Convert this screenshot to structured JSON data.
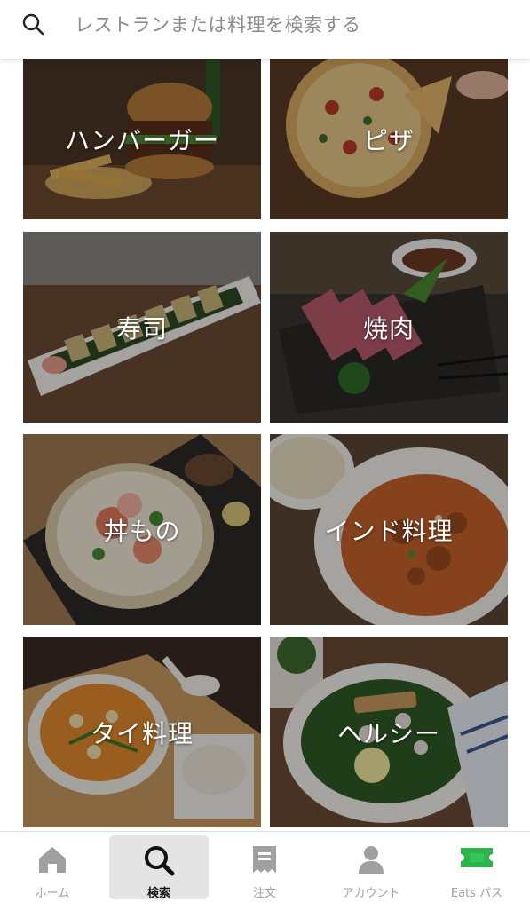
{
  "search": {
    "placeholder": "レストランまたは料理を検索する",
    "icon": "search-icon"
  },
  "categories": [
    {
      "label": "ハンバーガー"
    },
    {
      "label": "ピザ"
    },
    {
      "label": "寿司"
    },
    {
      "label": "焼肉"
    },
    {
      "label": "丼もの"
    },
    {
      "label": "インド料理"
    },
    {
      "label": "タイ料理"
    },
    {
      "label": "ヘルシー"
    }
  ],
  "tabbar": {
    "items": [
      {
        "label": "ホーム",
        "icon": "home-icon"
      },
      {
        "label": "検索",
        "icon": "search-icon"
      },
      {
        "label": "注文",
        "icon": "receipt-icon"
      },
      {
        "label": "アカウント",
        "icon": "person-icon"
      },
      {
        "label": "Eats パス",
        "icon": "ticket-icon"
      }
    ],
    "active_index": 1
  },
  "colors": {
    "accent_green": "#2cb34a",
    "inactive_gray": "#a0a0a0",
    "active_bg": "#e4e4e4"
  }
}
